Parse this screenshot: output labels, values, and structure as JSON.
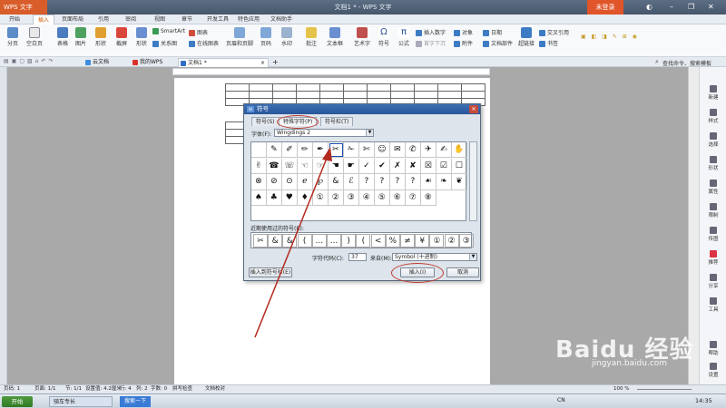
{
  "window": {
    "app_name": "WPS 文字",
    "title": "文档1 * - WPS 文字",
    "login": "未登录"
  },
  "menu": [
    "开始",
    "插入",
    "页面布局",
    "引用",
    "审阅",
    "视图",
    "章节",
    "开发工具",
    "特色应用",
    "文档助手"
  ],
  "ribbon": {
    "large": [
      "分页",
      "空白页",
      "表格",
      "图片",
      "形状",
      "截屏",
      "形状",
      "页眉和页脚",
      "页码",
      "水印",
      "批注",
      "文本框",
      "艺术字",
      "符号",
      "公式",
      "超链接"
    ],
    "small": [
      "SmartArt",
      "图表",
      "关系图",
      "在线图表",
      "插入数字",
      "对象",
      "日期",
      "首字下沉",
      "附件",
      "文档部件",
      "交叉引用",
      "书签"
    ]
  },
  "tabs": [
    {
      "label": "云文档",
      "color": "#3c8dde"
    },
    {
      "label": "我的WPS",
      "color": "#d9322a"
    },
    {
      "label": "文档1 *",
      "color": "#2f6ec2"
    }
  ],
  "search_hint": "查找命令、搜索模板",
  "dialog": {
    "title": "符号",
    "tabs": [
      "符号(S)",
      "特殊字符(P)",
      "符号栏(T)"
    ],
    "font_label": "字体(F):",
    "font_value": "Wingdings 2",
    "symbols": [
      "",
      "✎",
      "✐",
      "✏",
      "✒",
      "✂",
      "✁",
      "✄",
      "☺",
      "✉",
      "✆",
      "✈",
      "✍",
      "✋",
      "✌",
      "☎",
      "☏",
      "☜",
      "☞",
      "☚",
      "☛",
      "✓",
      "✔",
      "✗",
      "✘",
      "☒",
      "☑",
      "☐",
      "⊗",
      "⊘",
      "⊙",
      "ℯ",
      "℘",
      "&",
      "ℰ",
      "?",
      "?",
      "?",
      "?",
      "☙",
      "❧",
      "❦",
      "♠",
      "♣",
      "♥",
      "♦",
      "①",
      "②",
      "③",
      "④",
      "⑤",
      "⑥",
      "⑦",
      "⑧"
    ],
    "recent_label": "近期使用过的符号(R):",
    "recent": [
      "✂",
      "&",
      "&",
      "(",
      "...",
      "...",
      ")",
      "(",
      "<",
      "%",
      "≠",
      "¥",
      "①",
      "②",
      "③"
    ],
    "code_label": "字符代码(C):",
    "code_value": "37",
    "from_label": "来自(M):",
    "from_value": "Symbol (十进制)",
    "insert_to_bar": "插入到符号栏(E)",
    "insert": "插入(I)",
    "cancel": "取消"
  },
  "right_panel": [
    "新建",
    "样式",
    "选择",
    "形状",
    "属性",
    "限制",
    "传图",
    "推荐",
    "分享",
    "工具",
    "帮助",
    "设置"
  ],
  "status": {
    "page": "页码: 1",
    "pages": "页面: 1/1",
    "section": "节: 1/1",
    "settings": "设置值: 4.2厘米",
    "row": "行: 4",
    "col": "列: 2",
    "chars": "字数: 0",
    "spell": "拼写检查",
    "proof": "文档校对",
    "zoom": "100 %"
  },
  "taskbar": {
    "start": "开始",
    "items": [
      "骑车专长",
      "搜索一下"
    ],
    "clock": "14:35",
    "ime": "CN"
  },
  "watermark": "Baidu 经验",
  "watermark_url": "jingyan.baidu.com"
}
